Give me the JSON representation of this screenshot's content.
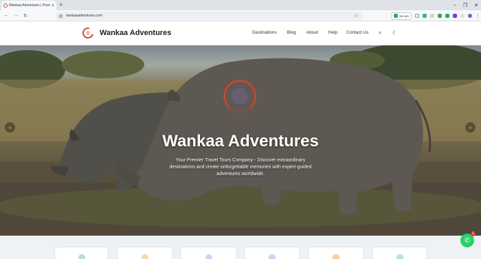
{
  "browser": {
    "tab_title": "Wankaa Adventures | Premier Travel",
    "tab_close": "×",
    "new_tab": "+",
    "window_controls": [
      "–",
      "❐",
      "✕"
    ],
    "back": "←",
    "forward": "→",
    "reload": "↻",
    "url": "wankaaadventures.com",
    "bookmark_icon": "☆",
    "extension_label": "Sa ves",
    "menu": "⋮"
  },
  "header": {
    "brand": "Wankaa Adventures",
    "nav": [
      "Destinations",
      "Blog",
      "About",
      "Help",
      "Contact Us"
    ],
    "search_icon": "⌕",
    "theme_icon": "☾"
  },
  "hero": {
    "title": "Wankaa Adventures",
    "subtitle": "Your Premier Travel Tours Company - Discover extraordinary destinations and create unforgettable memories with expert-guided adventures worldwide.",
    "prev": "‹",
    "next": "›"
  },
  "cards": {
    "count": 6,
    "icon_colors": [
      "#7fc4a8",
      "#f2b36b",
      "#9ab9e0",
      "#b7a6e6",
      "#f0a25a",
      "#7cc7c9"
    ]
  },
  "whatsapp": {
    "icon": "✆",
    "badge": "1"
  },
  "colors": {
    "accent": "#d4462b",
    "whatsapp": "#25d366"
  }
}
